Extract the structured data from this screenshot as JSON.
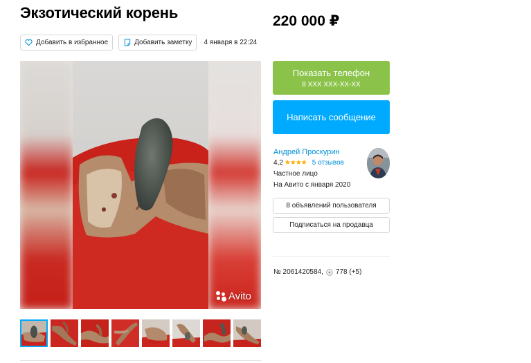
{
  "listing": {
    "title": "Экзотический корень",
    "price": "220 000 ₽",
    "date": "4 января в 22:24",
    "number": "№ 2061420584,",
    "views": "778 (+5)"
  },
  "toolbar": {
    "favorite_label": "Добавить в избранное",
    "note_label": "Добавить заметку"
  },
  "photo": {
    "watermark": "Avito",
    "thumbnails_count": 8
  },
  "contact": {
    "phone_label": "Показать телефон",
    "phone_masked": "8 XXX XXX-XX-XX",
    "message_label": "Написать сообщение"
  },
  "seller": {
    "name": "Андрей Проскурин",
    "rating": "4,2",
    "stars": "★★★★",
    "reviews": "5 отзывов",
    "type": "Частное лицо",
    "since": "На Авито с января 2020"
  },
  "seller_actions": {
    "listings_label": "8 объявлений пользователя",
    "subscribe_label": "Подписаться на продавца"
  },
  "colors": {
    "phone_button": "#8bc34a",
    "message_button": "#00aaff",
    "link": "#0091d9",
    "star": "#ffaa00"
  }
}
